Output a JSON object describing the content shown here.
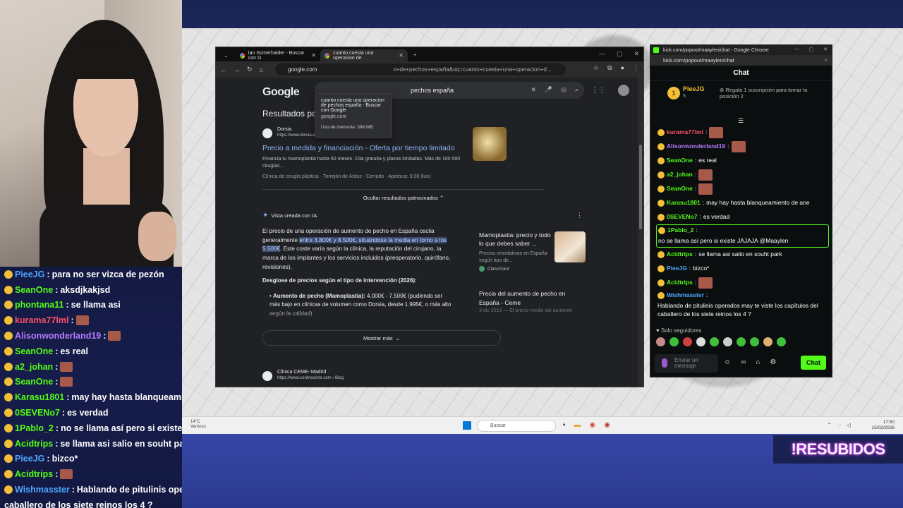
{
  "browser": {
    "tabs": [
      {
        "title": "Ian Somerhalder - Buscar con G"
      },
      {
        "title": "cuanto cuesta una operacion de"
      }
    ],
    "address": "google.com",
    "address_rest": "n+de+pechos+españa&oq=cuanto+cuesta+una+operacion+d...",
    "tooltip": {
      "title": "cuanto cuesta una operacion de pechos españa - Buscar con Google",
      "url": "google.com",
      "memory": "Uso de memoria: 398 MB"
    },
    "search": {
      "logo": "Google",
      "query": "pechos españa"
    },
    "page": {
      "sponsored_heading": "Resultados patrocinados",
      "ad": {
        "name": "Dorsia",
        "url": "https://www.dorsia.es",
        "title": "Precio a medida y financiación - Oferta por tiempo limitado",
        "desc": "Financia tu mamoplastia hasta 60 meses. Cita gratuita y plazas limitadas. Más de 100 000 cirugías...",
        "meta": "Clínica de cirugía plástica · Torrejón de Ardoz · Cerrado · Apertura: 9:30 (lun)"
      },
      "hide_ads": "Ocultar resultados patrocinados",
      "ai_label": "Vista creada con IA",
      "ai_text_a": "El precio de una operación de aumento de pecho en España oscila generalmente ",
      "ai_text_hl": "entre 3.800€ y 8.500€, situándose la media en torno a los 5.500€",
      "ai_text_b": ". Este coste varía según la clínica, la reputación del cirujano, la marca de los implantes y los servicios incluidos (preoperatorio, quirófano, revisiones).",
      "ai_sub": "Desglose de precios según el tipo de intervención (2026):",
      "ai_bullet_bold": "Aumento de pecho (Mamoplastia):",
      "ai_bullet_text": " 4.000€ - 7.500€ (pudiendo ser más bajo en clínicas de volumen como Dorsia, desde 1.995€, o más alto según la calidad).",
      "side_title": "Mamoplastia: precio y todo lo que debes saber ...",
      "side_desc": "Precios orientativos en España según tipo de...",
      "side_src": "ClinicPoint",
      "side2_title": "Precio del aumento de pecho en España - Ceme",
      "side2_meta": "3 dic 2019 — El precio medio del aumento",
      "show_more": "Mostrar más",
      "result2_name": "Clínica CEME- Madrid",
      "result2_url": "https://www.centroceme.com › Blog"
    }
  },
  "kick": {
    "window_title": "kick.com/popout/maaylen/chat - Google Chrome",
    "url": "kick.com/popout/maaylen/chat",
    "header": "Chat",
    "pinned": {
      "user": "PieeJG",
      "count": "5",
      "badge": "1",
      "gift": "Regala 1 suscripción para tomar la posición 2"
    },
    "messages": [
      {
        "user": "kurama77lml",
        "color": "#ff4f6a",
        "text": ""
      },
      {
        "user": "Alisonwonderland19",
        "color": "#b57bff",
        "text": ""
      },
      {
        "user": "SeanOne",
        "color": "#53fc18",
        "text": "es real"
      },
      {
        "user": "a2_johan",
        "color": "#53fc18",
        "text": ""
      },
      {
        "user": "SeanOne",
        "color": "#53fc18",
        "text": ""
      },
      {
        "user": "Karasu1801",
        "color": "#53fc18",
        "text": "may hay hasta blanqueamiento de ane"
      },
      {
        "user": "0SEVENo7",
        "color": "#53fc18",
        "text": "es verdad"
      },
      {
        "user": "1Pablo_2",
        "color": "#53fc18",
        "text": "no se llama así pero si existe JAJAJA @Maaylen"
      },
      {
        "user": "Acidtrips",
        "color": "#53fc18",
        "text": "se llama asi salio en souht park"
      },
      {
        "user": "PieeJG",
        "color": "#4ea6ff",
        "text": "bizco*"
      },
      {
        "user": "Acidtrips",
        "color": "#53fc18",
        "text": ""
      },
      {
        "user": "Wishmasster",
        "color": "#4ea6ff",
        "text": "Hablando de pitulinis operados may te viste los capítulos del caballero de los siete reinos los 4 ?"
      }
    ],
    "followers_only": "Solo seguidores",
    "input_placeholder": "Enviar un mensaje",
    "send": "Chat"
  },
  "overlay_chat": [
    {
      "user": "PieeJG",
      "color": "#4ea6ff",
      "text": "para no ser vizca de pezón"
    },
    {
      "user": "SeanOne",
      "color": "#53fc18",
      "text": "aksdjkakjsd"
    },
    {
      "user": "phontana11",
      "color": "#53fc18",
      "text": "se llama asi"
    },
    {
      "user": "kurama77lml",
      "color": "#ff4f6a",
      "text": ""
    },
    {
      "user": "Alisonwonderland19",
      "color": "#b57bff",
      "text": ""
    },
    {
      "user": "SeanOne",
      "color": "#53fc18",
      "text": "es real"
    },
    {
      "user": "a2_johan",
      "color": "#53fc18",
      "text": ""
    },
    {
      "user": "SeanOne",
      "color": "#53fc18",
      "text": ""
    },
    {
      "user": "Karasu1801",
      "color": "#53fc18",
      "text": "may hay hasta blanqueami"
    },
    {
      "user": "0SEVENo7",
      "color": "#53fc18",
      "text": "es verdad"
    },
    {
      "user": "1Pablo_2",
      "color": "#53fc18",
      "text": "no se llama así pero si existe JAJ"
    },
    {
      "user": "Acidtrips",
      "color": "#53fc18",
      "text": "se llama asi salio en souht park"
    },
    {
      "user": "PieeJG",
      "color": "#4ea6ff",
      "text": "bizco*"
    },
    {
      "user": "Acidtrips",
      "color": "#53fc18",
      "text": ""
    },
    {
      "user": "Wishmasster",
      "color": "#4ea6ff",
      "text": "Hablando de pitulinis operados"
    },
    {
      "user": "",
      "color": "#ffffff",
      "text": "caballero de los siete reinos los 4 ?"
    }
  ],
  "taskbar": {
    "weather_temp": "14°C",
    "weather_desc": "Ventoso",
    "search": "Buscar",
    "time": "17:50",
    "date": "15/02/2026"
  },
  "resubidos": "!RESUBIDOS"
}
